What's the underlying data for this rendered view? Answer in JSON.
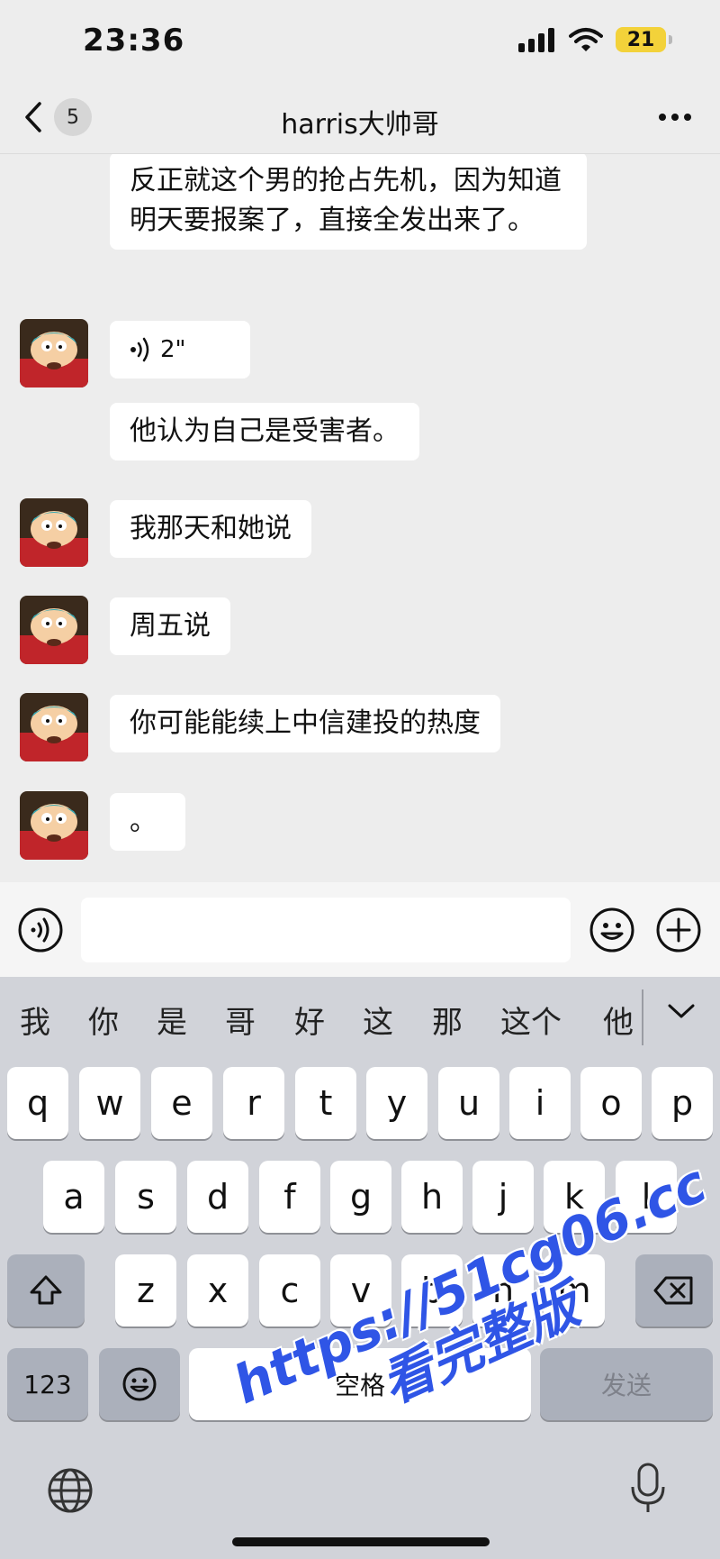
{
  "status_bar": {
    "time": "23:36",
    "battery": "21"
  },
  "nav": {
    "back_count": "5",
    "title": "harris大帅哥"
  },
  "messages": [
    {
      "type": "text",
      "text": "反正就这个男的抢占先机，因为知道明天要报案了，直接全发出来了。"
    },
    {
      "type": "voice",
      "duration": "2\""
    },
    {
      "type": "text",
      "text": "他认为自己是受害者。"
    },
    {
      "type": "text",
      "text": "我那天和她说"
    },
    {
      "type": "text",
      "text": "周五说"
    },
    {
      "type": "text",
      "text": "你可能能续上中信建投的热度"
    },
    {
      "type": "text",
      "text": "。"
    }
  ],
  "keyboard": {
    "candidates": [
      "我",
      "你",
      "是",
      "哥",
      "好",
      "这",
      "那",
      "这个",
      "他"
    ],
    "row1": [
      "q",
      "w",
      "e",
      "r",
      "t",
      "y",
      "u",
      "i",
      "o",
      "p"
    ],
    "row2": [
      "a",
      "s",
      "d",
      "f",
      "g",
      "h",
      "j",
      "k",
      "l"
    ],
    "row3": [
      "z",
      "x",
      "c",
      "v",
      "b",
      "n",
      "m"
    ],
    "numbers_label": "123",
    "space_label": "空格",
    "send_label": "发送"
  },
  "watermark": {
    "line1": "https://51cg06.cc",
    "line2": "看完整版"
  },
  "colors": {
    "background": "#ededed",
    "bubble": "#ffffff",
    "keyboard": "#d1d3d9",
    "watermark": "#2f55e6",
    "battery": "#f3d23a"
  }
}
